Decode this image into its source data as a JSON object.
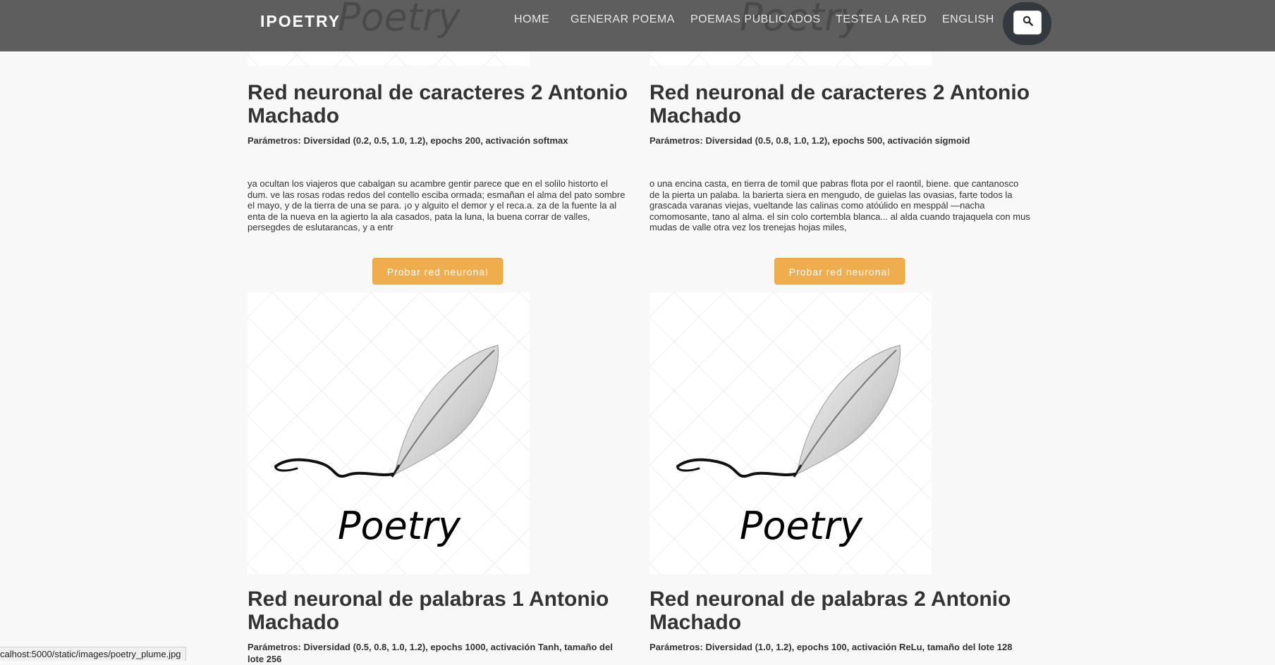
{
  "nav": {
    "brand": "IPOETRY",
    "items": [
      {
        "label": "HOME"
      },
      {
        "label": "GENERAR POEMA"
      },
      {
        "label": "POEMAS PUBLICADOS"
      },
      {
        "label": "TESTEA LA RED"
      },
      {
        "label": "ENGLISH"
      }
    ],
    "search_icon": "search-icon"
  },
  "image_text": "Poetry",
  "cards": [
    {
      "title": "Red neuronal de caracteres 2 Antonio Machado",
      "params": "Parámetros: Diversidad (0.2, 0.5, 1.0, 1.2), epochs 200, activación softmax",
      "poem": "ya ocultan los viajeros que cabalgan su acambre gentir parece que en el solilo historto el dum. ve las rosas rodas redos del contello esciba ormada; esmañan el alma del pato sombre el mayo, y de la tierra de una se para. ¡o y alguito el demor y el reca.a. za de la fuente la al enta de la nueva en la agierto la ala casados, pata la luna, la buena corrar de valles, persegdes de eslutarancas, y a entr",
      "button": "Probar red neuronal"
    },
    {
      "title": "Red neuronal de caracteres 2 Antonio Machado",
      "params": "Parámetros: Diversidad (0.5, 0.8, 1.0, 1.2), epochs 500, activación sigmoid",
      "poem": "o una encina casta, en tierra de tomil que pabras flota por el raontil, biene. que cantanosco de la pierta un palaba. la barierta siera en mengudo, de guielas las ovasias, farte todos la grascada varanas viejas, vueltande las calinas como atóúlido en mesppál —nacha comomosante, tano al alma. el sin colo cortembla blanca... al alda cuando trajaquela con mus mudas de valle otra vez los trenejas hojas miles,",
      "button": "Probar red neuronal"
    },
    {
      "title": "Red neuronal de palabras 1 Antonio Machado",
      "params": "Parámetros: Diversidad (0.5, 0.8, 1.0, 1.2), epochs 1000, activación Tanh, tamaño del lote 256"
    },
    {
      "title": "Red neuronal de palabras 2 Antonio Machado",
      "params": "Parámetros: Diversidad (1.0, 1.2), epochs 100, activación ReLu, tamaño del lote 128"
    }
  ],
  "status_bar": "calhost:5000/static/images/poetry_plume.jpg"
}
